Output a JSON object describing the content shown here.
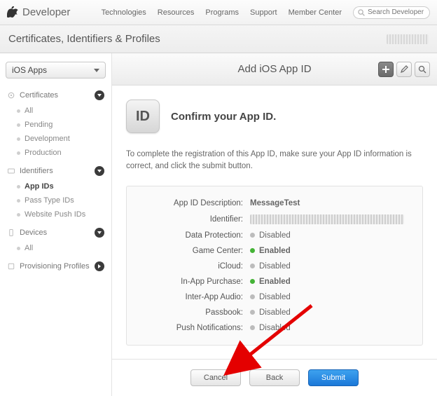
{
  "topnav": {
    "brand": "Developer",
    "links": [
      "Technologies",
      "Resources",
      "Programs",
      "Support",
      "Member Center"
    ],
    "search_placeholder": "Search Developer"
  },
  "titlebar": {
    "title": "Certificates, Identifiers & Profiles"
  },
  "sidebar": {
    "selector_label": "iOS Apps",
    "groups": [
      {
        "label": "Certificates",
        "items": [
          "All",
          "Pending",
          "Development",
          "Production"
        ],
        "expanded": true
      },
      {
        "label": "Identifiers",
        "items": [
          "App IDs",
          "Pass Type IDs",
          "Website Push IDs"
        ],
        "expanded": true,
        "active_item": "App IDs"
      },
      {
        "label": "Devices",
        "items": [
          "All"
        ],
        "expanded": true
      },
      {
        "label": "Provisioning Profiles",
        "items": [],
        "expanded": false
      }
    ]
  },
  "main": {
    "heading": "Add iOS App ID",
    "hero_badge": "ID",
    "hero_title": "Confirm your App ID.",
    "blurb": "To complete the registration of this App ID, make sure your App ID information is correct, and click the submit button.",
    "rows": [
      {
        "label": "App ID Description:",
        "value": "MessageTest",
        "status": null
      },
      {
        "label": "Identifier:",
        "value": "",
        "status": null,
        "blurred": true
      },
      {
        "label": "Data Protection:",
        "value": "Disabled",
        "status": "disabled"
      },
      {
        "label": "Game Center:",
        "value": "Enabled",
        "status": "enabled"
      },
      {
        "label": "iCloud:",
        "value": "Disabled",
        "status": "disabled"
      },
      {
        "label": "In-App Purchase:",
        "value": "Enabled",
        "status": "enabled"
      },
      {
        "label": "Inter-App Audio:",
        "value": "Disabled",
        "status": "disabled"
      },
      {
        "label": "Passbook:",
        "value": "Disabled",
        "status": "disabled"
      },
      {
        "label": "Push Notifications:",
        "value": "Disabled",
        "status": "disabled"
      }
    ],
    "buttons": {
      "cancel": "Cancel",
      "back": "Back",
      "submit": "Submit"
    }
  }
}
